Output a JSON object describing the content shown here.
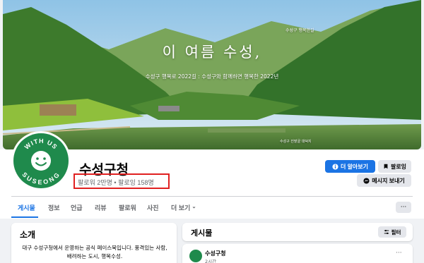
{
  "cover": {
    "headline": "이 여름 수성,",
    "subtitle": "수성구 행복로 2022길 : 수성구와 함께하면 행복한 2022년",
    "logo_text": "수성구 행복한길",
    "caption": "수성구 진밭골 대덕지"
  },
  "profile": {
    "avatar_text_top": "WITH US",
    "avatar_text_bottom": "SUSEONG",
    "name": "수성구청",
    "followers": "팔로워 2만명",
    "separator": "•",
    "following": "팔로잉 158명",
    "learn_more_label": "더 알아보기",
    "follow_label": "팔로잉",
    "message_label": "메시지 보내기"
  },
  "tabs": [
    {
      "label": "게시물"
    },
    {
      "label": "정보"
    },
    {
      "label": "언급"
    },
    {
      "label": "리뷰"
    },
    {
      "label": "팔로워"
    },
    {
      "label": "사진"
    },
    {
      "label": "더 보기"
    }
  ],
  "more_button_label": "···",
  "intro": {
    "title": "소개",
    "text": "대구 수성구청에서 운영하는 공식 페이스북입니다. 풍격있는 사람, 배려하는 도시, 행복수성."
  },
  "posts": {
    "title": "게시물",
    "filter_label": "필터"
  },
  "post": {
    "author": "수성구청",
    "time": "2시간",
    "more_label": "···"
  },
  "icons": {
    "info": "info-icon",
    "bookmark": "bookmark-icon",
    "messenger": "messenger-icon",
    "filter": "filter-icon",
    "chevron": "chevron-down-icon"
  },
  "colors": {
    "accent": "#1b74e4",
    "highlight": "#e02020",
    "avatar_green": "#1f8a4c"
  }
}
